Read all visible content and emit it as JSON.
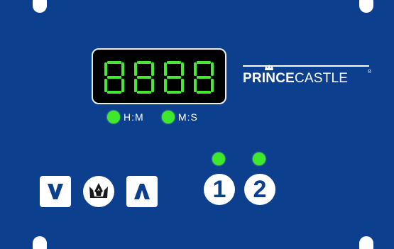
{
  "display": {
    "digits": "8888",
    "digit_color": "#46e834"
  },
  "indicators": [
    {
      "label": "H:M",
      "color": "#3ee82a"
    },
    {
      "label": "M:S",
      "color": "#3ee82a"
    }
  ],
  "brand": {
    "bold": "PRINCE",
    "regular": "CASTLE",
    "registered": "®"
  },
  "controls": {
    "down_icon": "chevron-down-icon",
    "crown_icon": "crown-icon",
    "up_icon": "chevron-up-icon"
  },
  "channels": [
    {
      "label": "1",
      "led_color": "#3ee82a"
    },
    {
      "label": "2",
      "led_color": "#3ee82a"
    }
  ],
  "colors": {
    "panel": "#0d3f8f",
    "key": "#ffffff",
    "led_green": "#3ee82a"
  }
}
